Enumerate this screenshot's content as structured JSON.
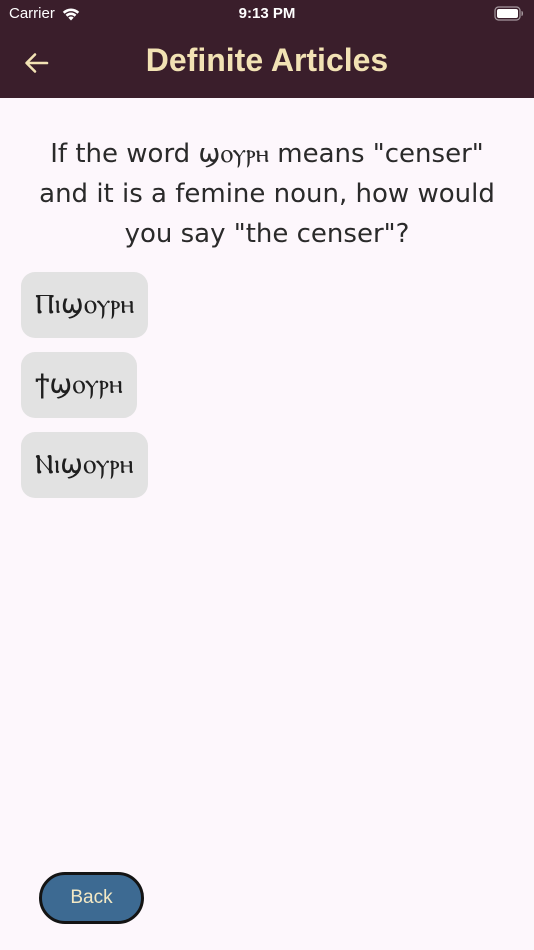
{
  "status_bar": {
    "carrier": "Carrier",
    "time": "9:13 PM",
    "wifi_icon": "wifi-icon",
    "battery_icon": "battery-icon"
  },
  "app_bar": {
    "title": "Definite Articles",
    "back_icon": "arrow-left-icon"
  },
  "question": {
    "text": "If the word ϣⲟⲩⲣⲏ means \"censer\" and it is a femine noun, how would you say \"the censer\"?"
  },
  "options": [
    {
      "label": "Ⲡⲓϣⲟⲩⲣⲏ"
    },
    {
      "label": "ϯϣⲟⲩⲣⲏ"
    },
    {
      "label": "Ⲛⲓϣⲟⲩⲣⲏ"
    }
  ],
  "footer": {
    "back_label": "Back"
  },
  "colors": {
    "app_bar_bg": "#3a1e2b",
    "title_color": "#f2e2b4",
    "page_bg": "#fdf7fc",
    "option_bg": "#e2e2e2",
    "back_button_bg": "#3d6a92"
  }
}
